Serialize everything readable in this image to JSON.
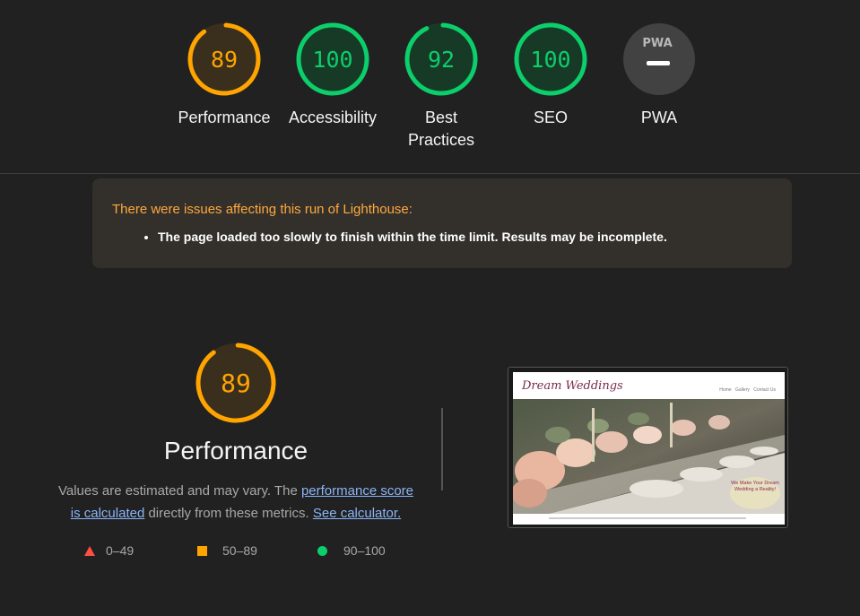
{
  "categories": [
    {
      "id": "performance",
      "score": "89",
      "score_value": 89,
      "label": "Performance",
      "status": "average"
    },
    {
      "id": "accessibility",
      "score": "100",
      "score_value": 100,
      "label": "Accessibility",
      "status": "pass"
    },
    {
      "id": "best_practices",
      "score": "92",
      "score_value": 92,
      "label": "Best Practices",
      "status": "pass"
    },
    {
      "id": "seo",
      "score": "100",
      "score_value": 100,
      "label": "SEO",
      "status": "pass"
    },
    {
      "id": "pwa",
      "score": "",
      "label": "PWA",
      "badge": "PWA",
      "status": "na"
    }
  ],
  "warning": {
    "title": "There were issues affecting this run of Lighthouse:",
    "items": [
      "The page loaded too slowly to finish within the time limit. Results may be incomplete."
    ]
  },
  "performance": {
    "score": "89",
    "score_value": 89,
    "title": "Performance",
    "desc_before": "Values are estimated and may vary. The ",
    "link1": "performance score is calculated",
    "desc_middle": " directly from these metrics. ",
    "link2": "See calculator."
  },
  "legend": [
    {
      "shape": "triangle",
      "range": "0–49",
      "color": "#ff4e42"
    },
    {
      "shape": "square",
      "range": "50–89",
      "color": "#ffa400"
    },
    {
      "shape": "circle",
      "range": "90–100",
      "color": "#0cce6b"
    }
  ],
  "screenshot": {
    "site_title": "Dream Weddings",
    "nav": [
      "Home",
      "Gallery",
      "Contact Us"
    ],
    "badge": "We Make Your Dream Wedding a Reality!"
  },
  "colors": {
    "pass": "#0cce6b",
    "average": "#ffa400",
    "fail": "#ff4e42",
    "pass_bg": "#173a27",
    "average_bg": "#3a2f1d",
    "na": "#424242"
  }
}
